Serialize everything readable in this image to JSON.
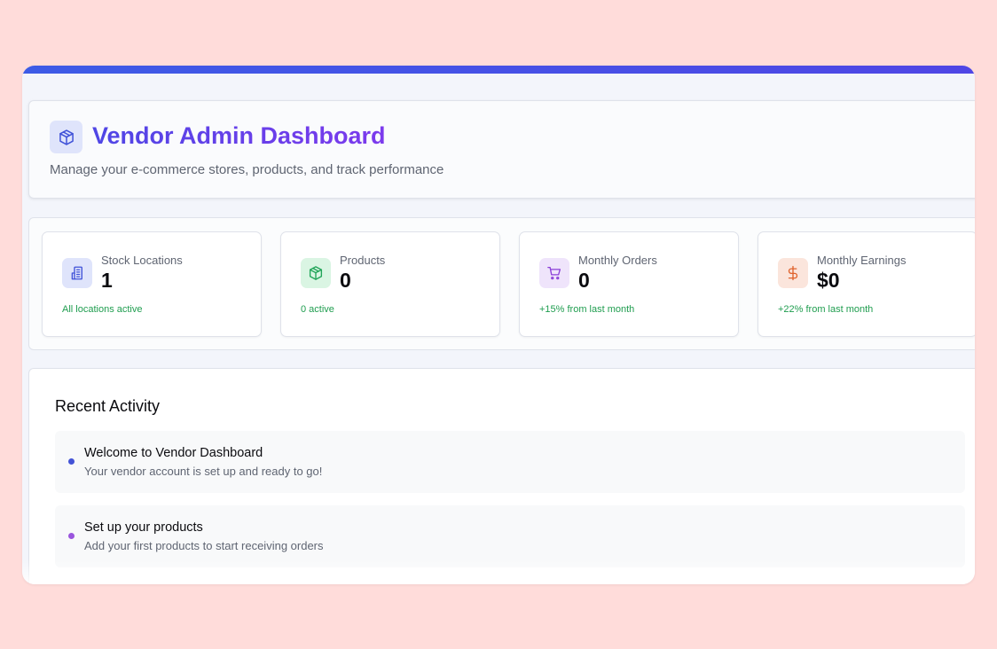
{
  "header": {
    "icon": "package-icon",
    "title": "Vendor Admin Dashboard",
    "subtitle": "Manage your e-commerce stores, products, and track performance"
  },
  "stats": [
    {
      "icon": "building-icon",
      "label": "Stock Locations",
      "value": "1",
      "note": "All locations active",
      "icon_bg": "#dfe4fb",
      "icon_color": "#3f51d8"
    },
    {
      "icon": "package-icon",
      "label": "Products",
      "value": "0",
      "note": "0 active",
      "icon_bg": "#daf5e3",
      "icon_color": "#22a559"
    },
    {
      "icon": "shopping-cart-icon",
      "label": "Monthly Orders",
      "value": "0",
      "note": "+15% from last month",
      "icon_bg": "#efe4fb",
      "icon_color": "#8b3fd8"
    },
    {
      "icon": "dollar-icon",
      "label": "Monthly Earnings",
      "value": "$0",
      "note": "+22% from last month",
      "icon_bg": "#fbe5dc",
      "icon_color": "#e0622c"
    }
  ],
  "activity": {
    "title": "Recent Activity",
    "items": [
      {
        "title": "Welcome to Vendor Dashboard",
        "description": "Your vendor account is set up and ready to go!",
        "dot_color": "#4353d6"
      },
      {
        "title": "Set up your products",
        "description": "Add your first products to start receiving orders",
        "dot_color": "#9a55dd"
      }
    ]
  }
}
